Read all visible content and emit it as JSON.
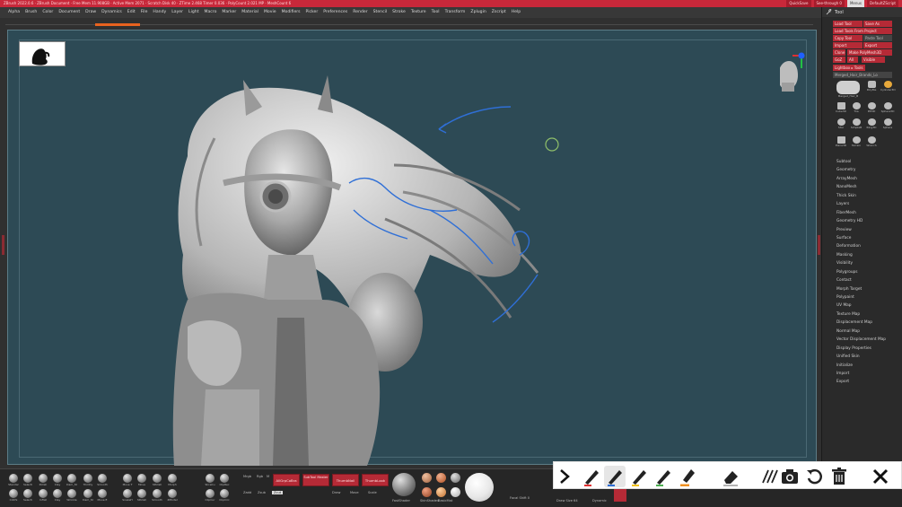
{
  "titlebar": {
    "title": "ZBrush 2022.0.6  ·  ZBrush Document  ·  Free Mem 11.908GB  ·  Active Mem 2071  ·  Scratch Disk 40  ·  ZTime 2.468 Timer 0.036  ·  PolyCount 2.021 MP  ·  MeshCount 6",
    "right_items": [
      "QuickSave",
      "See-through 0",
      "Menus",
      "DefaultZScript"
    ],
    "highlight": "Menus"
  },
  "menu": [
    "Alpha",
    "Brush",
    "Color",
    "Document",
    "Draw",
    "Dynamics",
    "Edit",
    "File",
    "Handy",
    "Layer",
    "Light",
    "Macro",
    "Marker",
    "Material",
    "Movie",
    "Modifiers",
    "Picker",
    "Preferences",
    "Render",
    "Stencil",
    "Stroke",
    "Texture",
    "Tool",
    "Transform",
    "Zplugin",
    "Zscript",
    "Help"
  ],
  "tool_panel": {
    "title": "Tool",
    "rows": [
      {
        "left": "Load Tool",
        "right": "Save As"
      },
      {
        "left": "Load Tools From Project",
        "right": ""
      },
      {
        "left": "Copy Tool",
        "right": "Paste Tool"
      },
      {
        "left": "Import",
        "right": "Export"
      },
      {
        "left": "Clone",
        "right": "Make PolyMesh3D"
      },
      {
        "left": "GoZ",
        "right": "All",
        "extra": "Visible"
      },
      {
        "left": "Lightbox ▸ Tools",
        "right": ""
      },
      {
        "left": "Merged_Hair_Brands_Lo",
        "right": ""
      }
    ],
    "brush_tools": [
      {
        "label": "Merged_Hair_B"
      },
      {
        "label": "PolyMe"
      },
      {
        "label": "Cylinder3D"
      },
      {
        "label": "Cube3D"
      },
      {
        "label": "Tria"
      },
      {
        "label": "PM3D"
      },
      {
        "label": "Sphere3D"
      },
      {
        "label": "Star"
      },
      {
        "label": "SimpleB"
      },
      {
        "label": "Ring3D"
      },
      {
        "label": "Sphere"
      },
      {
        "label": "Plane3D"
      },
      {
        "label": "Terrain"
      },
      {
        "label": "Wrench"
      }
    ],
    "sections": [
      "Subtool",
      "Geometry",
      "ArrayMesh",
      "NanoMesh",
      "Thick Skin",
      "Layers",
      "FiberMesh",
      "Geometry HD",
      "Preview",
      "Surface",
      "Deformation",
      "Masking",
      "Visibility",
      "Polygroups",
      "Contact",
      "Morph Target",
      "Polypaint",
      "UV Map",
      "Texture Map",
      "Displacement Map",
      "Normal Map",
      "Vector Displacement Map",
      "Display Properties",
      "Unified Skin",
      "Initialize",
      "Import",
      "Export"
    ]
  },
  "shelf": {
    "row1": [
      "Standar",
      "Selecti",
      "Polish",
      "Clay",
      "Dam_St",
      "TrimDy",
      "Smooth",
      "Move T",
      "Move",
      "hPolish",
      "Morph",
      "SliceCu",
      "ClipRec"
    ],
    "row2": [
      "Clothi",
      "Selecti",
      "Inflat",
      "Clay",
      "Wrinkle",
      "Dam_St",
      "Move E",
      "SnakeH",
      "hPolish",
      "Smooth",
      "ZModel",
      "ClipCur",
      "ClipCirc"
    ],
    "misc_labels": [
      "Mrgb",
      "Rgb",
      "M",
      "Zadd",
      "Zsub",
      "Zcut",
      "Draw",
      "Move",
      "Scale",
      "Rotate"
    ],
    "red_buttons": [
      {
        "label": "AllGrpCoBra"
      },
      {
        "label": "SubTool Master"
      },
      {
        "label": "ThumbNail"
      },
      {
        "label": "ThumbLook"
      }
    ],
    "mat_labels": [
      "FastShader",
      "SkinShade4",
      "BasicMat",
      "MatCap Gray"
    ],
    "status": [
      "Focal Shift 0",
      "Draw Size 64",
      "Dynamic"
    ]
  },
  "annotation_toolbar": {
    "tools": [
      "collapse",
      "red-pen",
      "blue-pen",
      "yellow-pen",
      "green-pen",
      "orange-marker",
      "eraser",
      "lines",
      "camera",
      "undo",
      "delete",
      "close"
    ]
  },
  "colors": {
    "canvas": "#2d4a55",
    "accent_red": "#b52a36",
    "accent_orange": "#e8621f",
    "stroke_blue": "#2f6fd6"
  }
}
